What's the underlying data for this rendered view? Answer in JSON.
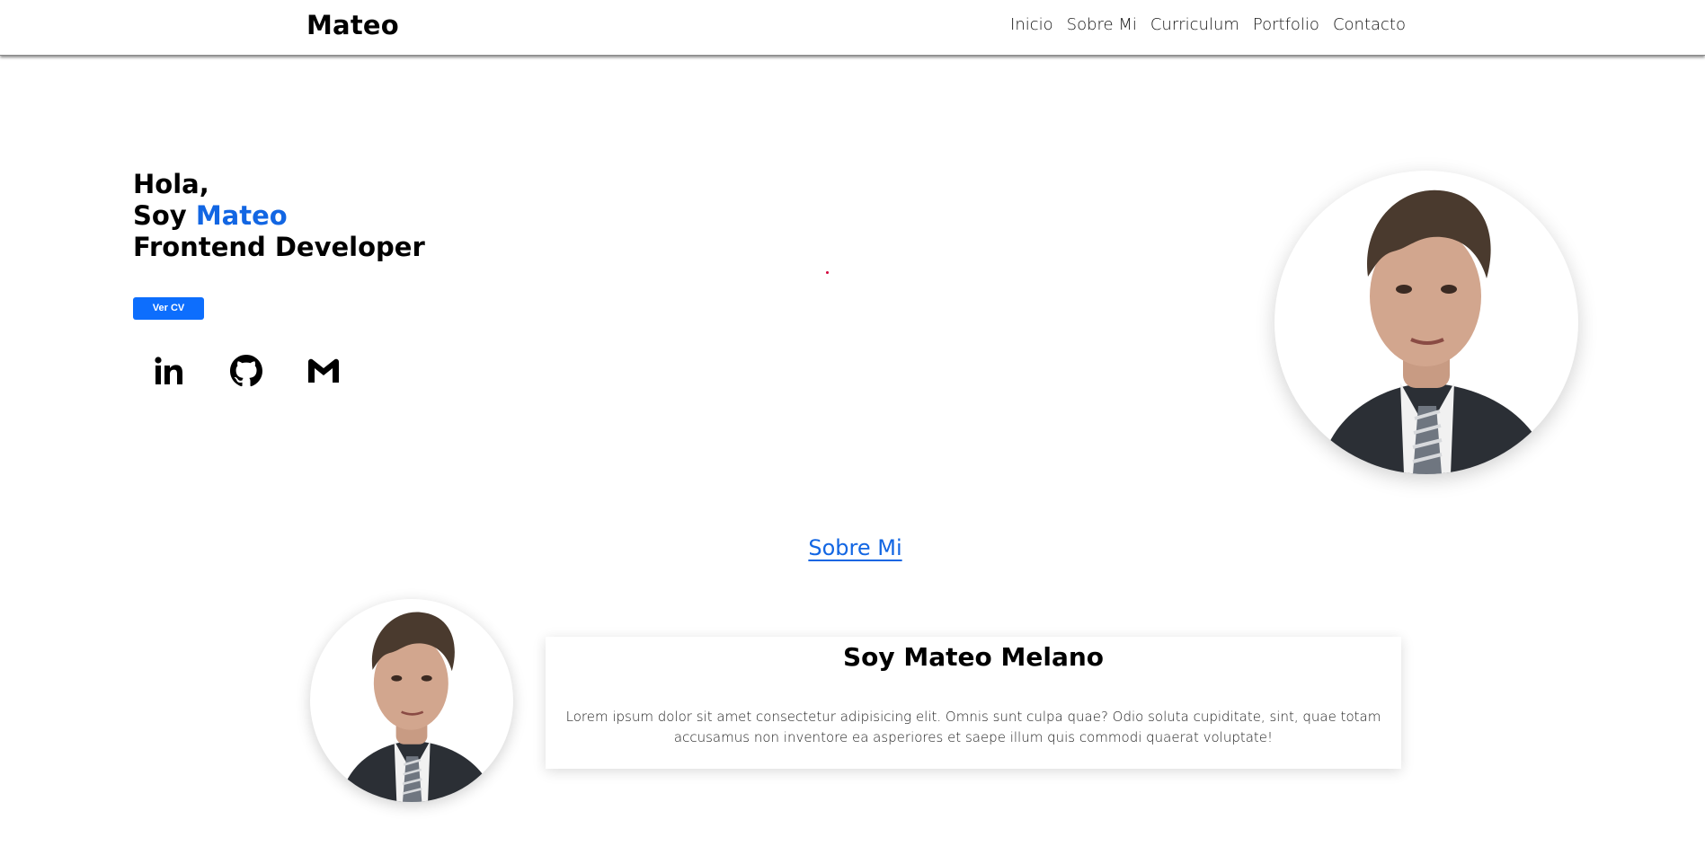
{
  "header": {
    "brand": "Mateo",
    "nav": [
      {
        "label": "Inicio"
      },
      {
        "label": "Sobre Mi"
      },
      {
        "label": "Curriculum"
      },
      {
        "label": "Portfolio"
      },
      {
        "label": "Contacto"
      }
    ]
  },
  "hero": {
    "greeting": "Hola,",
    "intro_prefix": "Soy",
    "name": "Mateo",
    "role": "Frontend Developer",
    "cv_button": "Ver CV",
    "socials": [
      {
        "icon": "linkedin-icon"
      },
      {
        "icon": "github-icon"
      },
      {
        "icon": "gmail-icon"
      }
    ]
  },
  "about": {
    "section_title": "Sobre Mi",
    "card_title": "Soy Mateo Melano",
    "card_text": "Lorem ipsum dolor sit amet consectetur adipisicing elit. Omnis sunt culpa quae? Odio soluta cupiditate, sint, quae totam accusamus non inventore ea asperiores et saepe illum quis commodi quaerat voluptate!"
  },
  "colors": {
    "accent": "#1266e3",
    "button": "#0d6efd"
  }
}
